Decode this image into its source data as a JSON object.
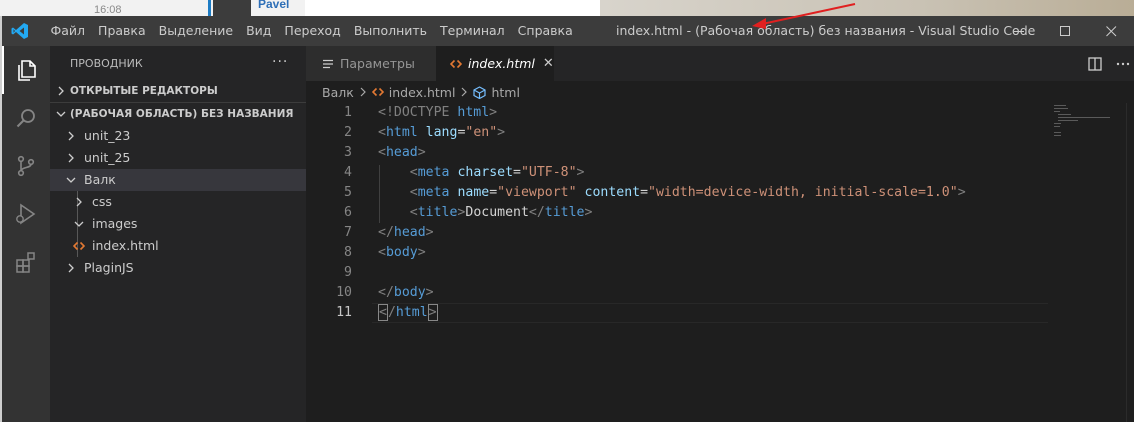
{
  "background_strip": {
    "clock_text": "16:08",
    "author_text": "Pavel"
  },
  "titlebar": {
    "menu": [
      "Файл",
      "Правка",
      "Выделение",
      "Вид",
      "Переход",
      "Выполнить",
      "Терминал",
      "Справка"
    ],
    "window_title": "index.html - (Рабочая область) без названия - Visual Studio Code",
    "icons": [
      "vscode-logo-icon",
      "minimize-icon",
      "maximize-icon",
      "close-icon"
    ]
  },
  "activity_bar": {
    "icons": [
      "explorer-icon",
      "search-icon",
      "source-control-icon",
      "run-debug-icon",
      "extensions-icon"
    ],
    "active": "explorer-icon"
  },
  "sidebar": {
    "title": "ПРОВОДНИК",
    "more": "···",
    "open_editors": "ОТКРЫТЫЕ РЕДАКТОРЫ",
    "workspace": "(РАБОЧАЯ ОБЛАСТЬ) БЕЗ НАЗВАНИЯ",
    "tree": [
      {
        "label": "unit_23",
        "type": "folder",
        "expanded": false
      },
      {
        "label": "unit_25",
        "type": "folder",
        "expanded": false
      },
      {
        "label": "Валк",
        "type": "folder",
        "expanded": true,
        "selected": true
      },
      {
        "label": "css",
        "type": "folder",
        "expanded": false
      },
      {
        "label": "images",
        "type": "folder",
        "expanded": true
      },
      {
        "label": "index.html",
        "type": "file",
        "icon": "html-file-icon"
      },
      {
        "label": "PlaginJS",
        "type": "folder",
        "expanded": false
      }
    ]
  },
  "tabs": [
    {
      "label": "Параметры",
      "icon": "settings-file-icon",
      "active": false
    },
    {
      "label": "index.html",
      "icon": "html-file-icon",
      "active": true,
      "close": "✕"
    }
  ],
  "breadcrumb": [
    "Валк",
    "index.html",
    "html"
  ],
  "editor": {
    "line_numbers": [
      "1",
      "2",
      "3",
      "4",
      "5",
      "6",
      "7",
      "8",
      "9",
      "10",
      "11"
    ],
    "current_line": "11",
    "lines": [
      [
        {
          "t": "<!DOCTYPE ",
          "c": "t-punc"
        },
        {
          "t": "html",
          "c": "t-tag"
        },
        {
          "t": ">",
          "c": "t-punc"
        }
      ],
      [
        {
          "t": "<",
          "c": "t-punc"
        },
        {
          "t": "html",
          "c": "t-tag"
        },
        {
          "t": " ",
          "c": "t-text"
        },
        {
          "t": "lang",
          "c": "t-attr"
        },
        {
          "t": "=",
          "c": "t-text"
        },
        {
          "t": "\"en\"",
          "c": "t-str"
        },
        {
          "t": ">",
          "c": "t-punc"
        }
      ],
      [
        {
          "t": "<",
          "c": "t-punc"
        },
        {
          "t": "head",
          "c": "t-tag"
        },
        {
          "t": ">",
          "c": "t-punc"
        }
      ],
      [
        {
          "t": "    ",
          "c": "t-text"
        },
        {
          "t": "<",
          "c": "t-punc"
        },
        {
          "t": "meta",
          "c": "t-tag"
        },
        {
          "t": " ",
          "c": "t-text"
        },
        {
          "t": "charset",
          "c": "t-attr"
        },
        {
          "t": "=",
          "c": "t-text"
        },
        {
          "t": "\"UTF-8\"",
          "c": "t-str"
        },
        {
          "t": ">",
          "c": "t-punc"
        }
      ],
      [
        {
          "t": "    ",
          "c": "t-text"
        },
        {
          "t": "<",
          "c": "t-punc"
        },
        {
          "t": "meta",
          "c": "t-tag"
        },
        {
          "t": " ",
          "c": "t-text"
        },
        {
          "t": "name",
          "c": "t-attr"
        },
        {
          "t": "=",
          "c": "t-text"
        },
        {
          "t": "\"viewport\"",
          "c": "t-str"
        },
        {
          "t": " ",
          "c": "t-text"
        },
        {
          "t": "content",
          "c": "t-attr"
        },
        {
          "t": "=",
          "c": "t-text"
        },
        {
          "t": "\"width=device-width, initial-scale=1.0\"",
          "c": "t-str"
        },
        {
          "t": ">",
          "c": "t-punc"
        }
      ],
      [
        {
          "t": "    ",
          "c": "t-text"
        },
        {
          "t": "<",
          "c": "t-punc"
        },
        {
          "t": "title",
          "c": "t-tag"
        },
        {
          "t": ">",
          "c": "t-punc"
        },
        {
          "t": "Document",
          "c": "t-text"
        },
        {
          "t": "</",
          "c": "t-punc"
        },
        {
          "t": "title",
          "c": "t-tag"
        },
        {
          "t": ">",
          "c": "t-punc"
        }
      ],
      [
        {
          "t": "</",
          "c": "t-punc"
        },
        {
          "t": "head",
          "c": "t-tag"
        },
        {
          "t": ">",
          "c": "t-punc"
        }
      ],
      [
        {
          "t": "<",
          "c": "t-punc"
        },
        {
          "t": "body",
          "c": "t-tag"
        },
        {
          "t": ">",
          "c": "t-punc"
        }
      ],
      [],
      [
        {
          "t": "</",
          "c": "t-punc"
        },
        {
          "t": "body",
          "c": "t-tag"
        },
        {
          "t": ">",
          "c": "t-punc"
        }
      ],
      [
        {
          "t": "<",
          "c": "t-punc bracket"
        },
        {
          "t": "/",
          "c": "t-punc"
        },
        {
          "t": "html",
          "c": "t-tag"
        },
        {
          "t": ">",
          "c": "t-punc bracket"
        }
      ]
    ]
  },
  "colors": {
    "titlebar": "#3c3c3c",
    "activity_bar": "#333333",
    "sidebar": "#252526",
    "editor": "#1e1e1e",
    "annotation_arrow": "#e02020"
  }
}
